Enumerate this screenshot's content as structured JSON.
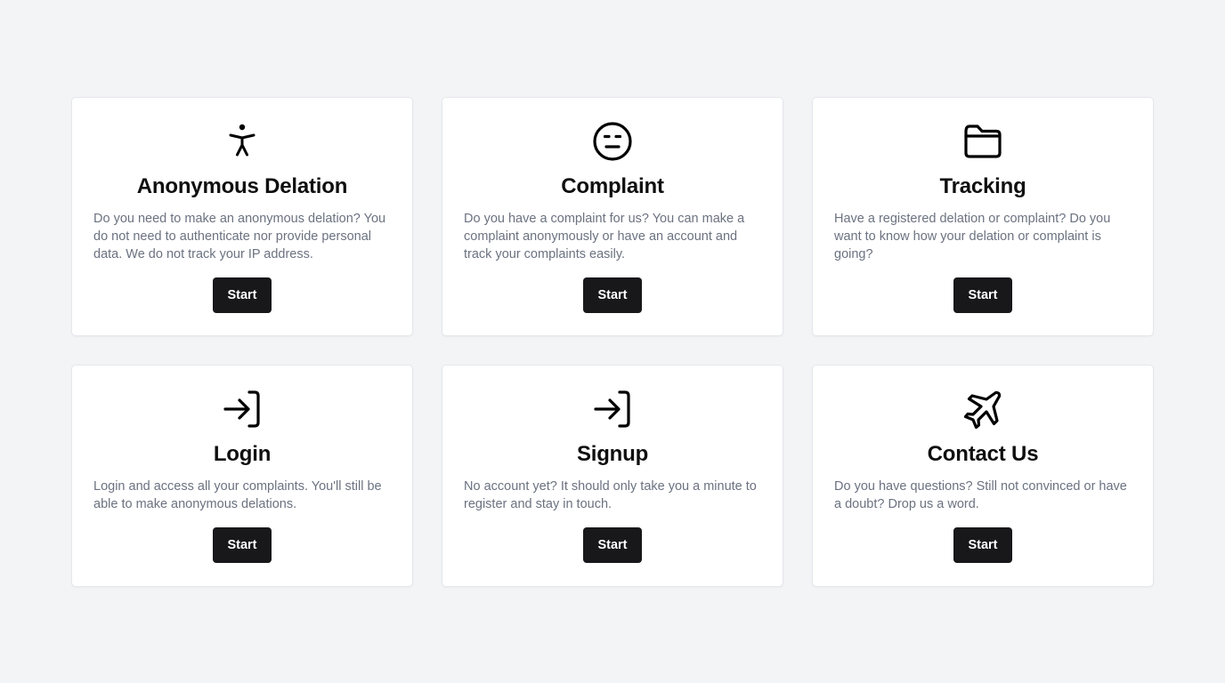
{
  "cards": [
    {
      "icon": "person-icon",
      "title": "Anonymous Delation",
      "description": "Do you need to make an anonymous delation? You do not need to authenticate nor provide personal data. We do not track your IP address.",
      "button_label": "Start"
    },
    {
      "icon": "neutral-face-icon",
      "title": "Complaint",
      "description": "Do you have a complaint for us? You can make a complaint anonymously or have an account and track your complaints easily.",
      "button_label": "Start"
    },
    {
      "icon": "folder-icon",
      "title": "Tracking",
      "description": "Have a registered delation or complaint? Do you want to know how your delation or complaint is going?",
      "button_label": "Start"
    },
    {
      "icon": "login-icon",
      "title": "Login",
      "description": "Login and access all your complaints. You'll still be able to make anonymous delations.",
      "button_label": "Start"
    },
    {
      "icon": "login-icon",
      "title": "Signup",
      "description": "No account yet? It should only take you a minute to register and stay in touch.",
      "button_label": "Start"
    },
    {
      "icon": "plane-icon",
      "title": "Contact Us",
      "description": "Do you have questions? Still not convinced or have a doubt? Drop us a word.",
      "button_label": "Start"
    }
  ],
  "colors": {
    "background": "#f3f4f6",
    "card": "#ffffff",
    "button": "#18181b",
    "title": "#0f0f10",
    "description": "#6b7280"
  }
}
